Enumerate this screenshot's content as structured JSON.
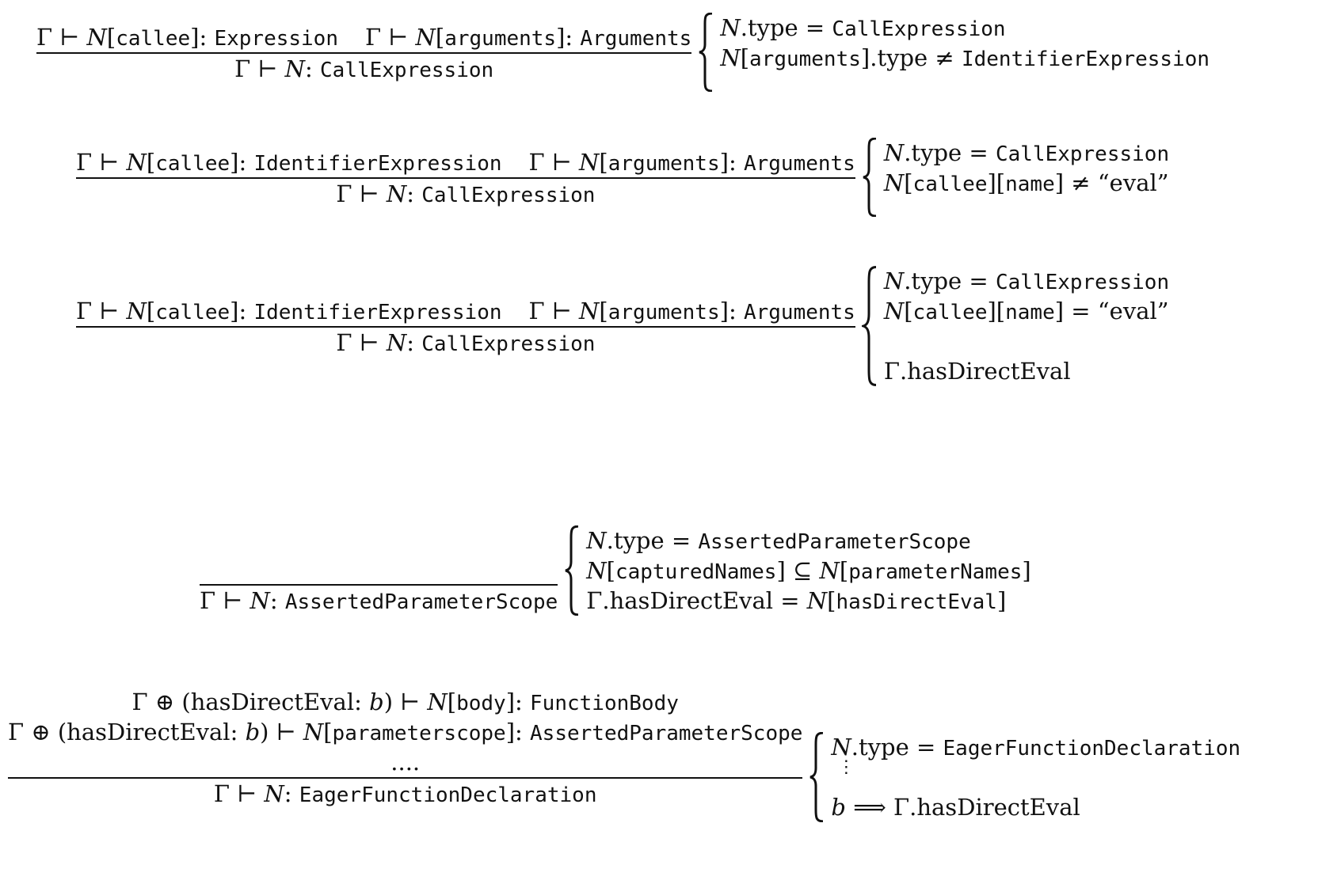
{
  "rules": [
    {
      "premises": [
        [
          {
            "ctx": "Γ ⊢ ",
            "n": "N",
            "key": "callee",
            "type": "Expression"
          },
          {
            "ctx": "Γ ⊢ ",
            "n": "N",
            "key": "arguments",
            "type": "Arguments"
          }
        ]
      ],
      "conclusion": {
        "ctx": "Γ ⊢ ",
        "n": "N",
        "type": "CallExpression"
      },
      "conditions": [
        {
          "lhs": "N",
          "field": ".type",
          "op": " = ",
          "rhs": "CallExpression"
        },
        {
          "lhs": "N",
          "key": "arguments",
          "field": ".type",
          "op": " ≠ ",
          "rhs": "IdentifierExpression"
        }
      ]
    },
    {
      "premises": [
        [
          {
            "ctx": "Γ ⊢ ",
            "n": "N",
            "key": "callee",
            "type": "IdentifierExpression"
          },
          {
            "ctx": "Γ ⊢ ",
            "n": "N",
            "key": "arguments",
            "type": "Arguments"
          }
        ]
      ],
      "conclusion": {
        "ctx": "Γ ⊢ ",
        "n": "N",
        "type": "CallExpression"
      },
      "conditions": [
        {
          "lhs": "N",
          "field": ".type",
          "op": " = ",
          "rhs": "CallExpression"
        },
        {
          "lhs": "N",
          "key": "callee",
          "key2": "name",
          "op": " ≠ ",
          "str": "“eval”"
        }
      ]
    },
    {
      "premises": [
        [
          {
            "ctx": "Γ ⊢ ",
            "n": "N",
            "key": "callee",
            "type": "IdentifierExpression"
          },
          {
            "ctx": "Γ ⊢ ",
            "n": "N",
            "key": "arguments",
            "type": "Arguments"
          }
        ]
      ],
      "conclusion": {
        "ctx": "Γ ⊢ ",
        "n": "N",
        "type": "CallExpression"
      },
      "conditions": [
        {
          "lhs": "N",
          "field": ".type",
          "op": " = ",
          "rhs": "CallExpression"
        },
        {
          "lhs": "N",
          "key": "callee",
          "key2": "name",
          "op": " = ",
          "str": "“eval”"
        },
        {
          "blank": true
        },
        {
          "plain": "Γ.hasDirectEval"
        }
      ]
    },
    {
      "premises": [],
      "conclusion": {
        "ctx": "Γ ⊢ ",
        "n": "N",
        "type": "AssertedParameterScope"
      },
      "conditions": [
        {
          "lhs": "N",
          "field": ".type",
          "op": " = ",
          "rhs": "AssertedParameterScope"
        },
        {
          "lhs": "N",
          "key": "capturedNames",
          "op": " ⊆ ",
          "lhs2": "N",
          "key3": "parameterNames"
        },
        {
          "pre": "Γ.hasDirectEval",
          "op": " = ",
          "lhs2": "N",
          "key3": "hasDirectEval"
        }
      ]
    },
    {
      "premises": [
        [
          {
            "ctx": "Γ ⊕ (hasDirectEval: ",
            "b": "b",
            "ctx2": ") ⊢ ",
            "n": "N",
            "key": "body",
            "type": "FunctionBody"
          }
        ],
        [
          {
            "ctx": "Γ ⊕ (hasDirectEval: ",
            "b": "b",
            "ctx2": ") ⊢ ",
            "n": "N",
            "key": "parameterscope",
            "type": "AssertedParameterScope"
          }
        ],
        [
          {
            "dots": "...."
          }
        ]
      ],
      "conclusion": {
        "ctx": "Γ ⊢ ",
        "n": "N",
        "type": "EagerFunctionDeclaration"
      },
      "conditions": [
        {
          "lhs": "N",
          "field": ".type",
          "op": " = ",
          "rhs": "EagerFunctionDeclaration"
        },
        {
          "vdots": "⋮"
        },
        {
          "bvar": "b",
          "op": " ⟹ ",
          "plain": "Γ.hasDirectEval"
        }
      ]
    }
  ]
}
